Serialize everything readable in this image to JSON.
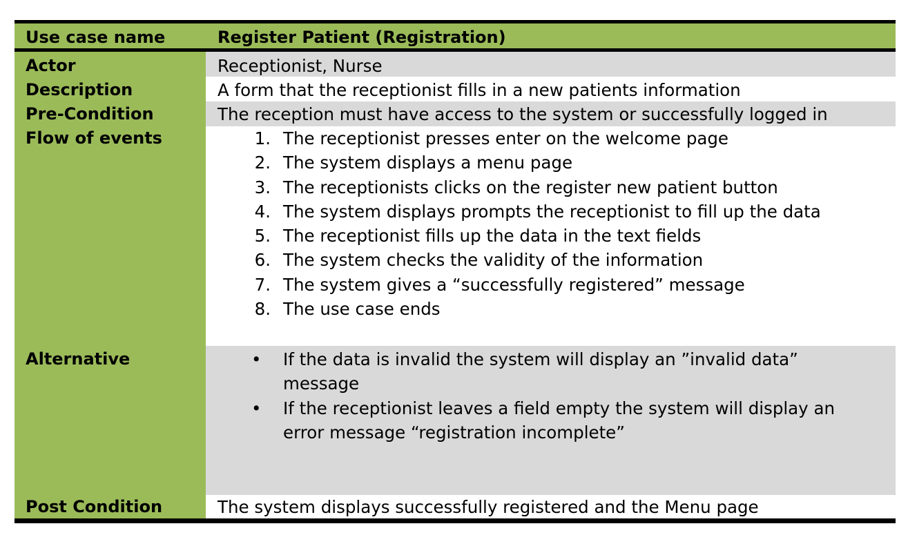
{
  "table": {
    "header": {
      "label": "Use case name",
      "value": "Register Patient (Registration)"
    },
    "actor": {
      "label": "Actor",
      "value": "Receptionist, Nurse"
    },
    "description": {
      "label": "Description",
      "value": "A form that the receptionist fills in a new patients information"
    },
    "pre_condition": {
      "label": "Pre-Condition",
      "value": "The reception must have access to the system or successfully logged in"
    },
    "flow_of_events": {
      "label": "Flow of events",
      "steps": [
        {
          "marker": "1.",
          "text": "The receptionist presses enter on the welcome page"
        },
        {
          "marker": "2.",
          "text": "The system displays a menu page"
        },
        {
          "marker": "3.",
          "text": "The receptionists clicks on the register new patient  button"
        },
        {
          "marker": "4.",
          "text": "The system displays prompts the receptionist to fill up the data"
        },
        {
          "marker": "5.",
          "text": "The receptionist fills up the data in the text fields"
        },
        {
          "marker": "6.",
          "text": "The system checks the validity of the information"
        },
        {
          "marker": "7.",
          "text": "The system gives a “successfully registered” message"
        },
        {
          "marker": "8.",
          "text": "The use case ends"
        }
      ]
    },
    "alternative": {
      "label": "Alternative",
      "items": [
        {
          "marker": "•",
          "line1": "If the data is invalid the system will display an ”invalid data”",
          "line2": "message"
        },
        {
          "marker": "•",
          "line1": "If the receptionist leaves a field empty the system will display an",
          "line2": "error message “registration incomplete”"
        }
      ]
    },
    "post_condition": {
      "label": "Post Condition",
      "value": "The system displays successfully registered and the Menu page"
    }
  },
  "colors": {
    "label_column": "#9bbb59",
    "shaded_row": "#d9d9d9",
    "rule": "#000000"
  }
}
